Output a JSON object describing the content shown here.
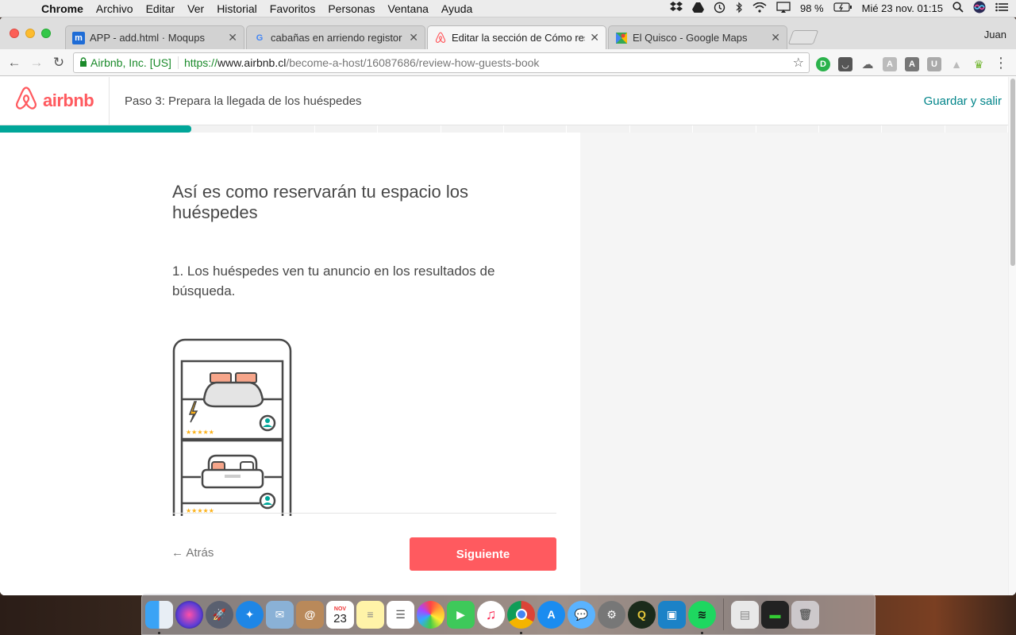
{
  "menubar": {
    "app_name": "Chrome",
    "items": [
      "Archivo",
      "Editar",
      "Ver",
      "Historial",
      "Favoritos",
      "Personas",
      "Ventana",
      "Ayuda"
    ],
    "battery": "98 %",
    "datetime": "Mié 23 nov.  01:15"
  },
  "browser": {
    "profile_name": "Juan",
    "tabs": [
      {
        "title": "APP - add.html · Moqups",
        "favicon": "m"
      },
      {
        "title": "cabañas en arriendo registor -",
        "favicon": "G"
      },
      {
        "title": "Editar la sección de Cómo rese",
        "favicon": "airbnb",
        "active": true
      },
      {
        "title": "El Quisco - Google Maps",
        "favicon": "maps"
      }
    ],
    "address": {
      "ev_label": "Airbnb, Inc. [US]",
      "scheme": "https://",
      "host": "www.airbnb.cl",
      "path": "/become-a-host/16087686/review-how-guests-book"
    }
  },
  "page": {
    "logo_text": "airbnb",
    "step_title": "Paso 3: Prepara la llegada de los huéspedes",
    "save_exit_label": "Guardar y salir",
    "progress_fraction": 0.19,
    "progress_segments": 16,
    "heading": "Así es como reservarán tu espacio los huéspedes",
    "step1_text": "1. Los huéspedes ven tu anuncio en los resultados de búsqueda.",
    "back_label": "← Atrás",
    "next_label": "Siguiente",
    "colors": {
      "brand": "#ff5a5f",
      "teal": "#00a699",
      "link": "#008489"
    }
  },
  "dock": {
    "calendar_month": "NOV",
    "calendar_day": "23"
  }
}
